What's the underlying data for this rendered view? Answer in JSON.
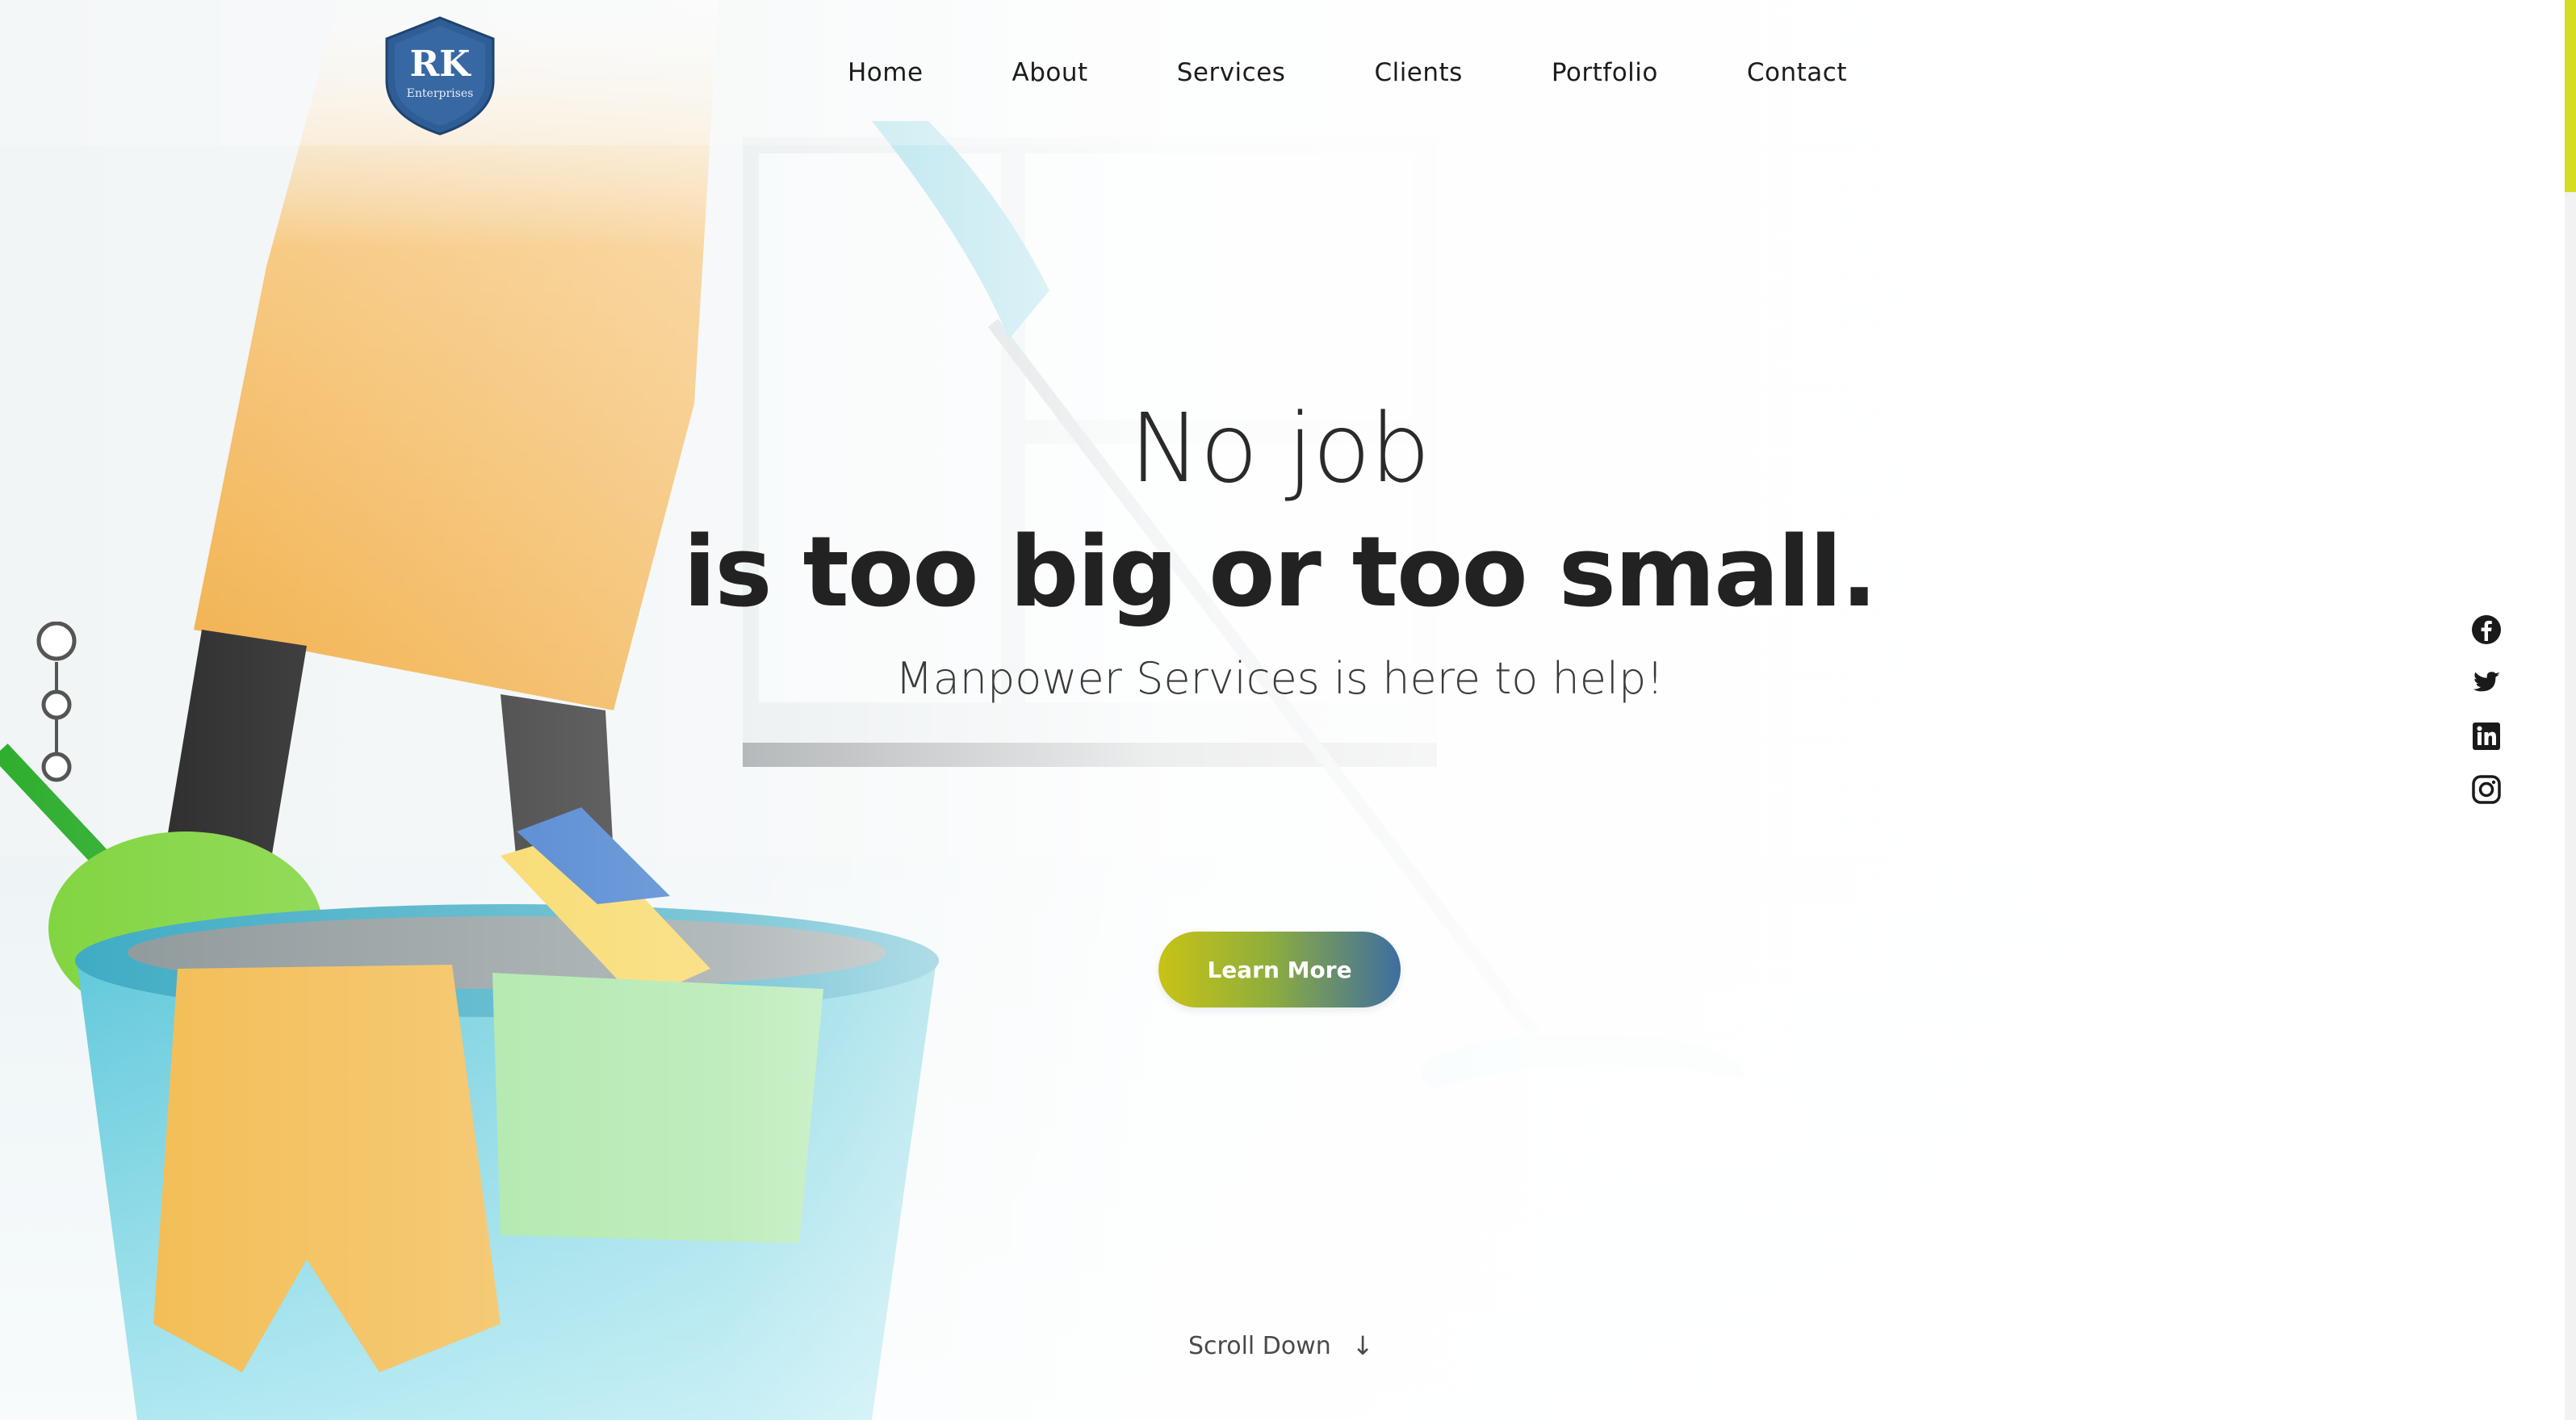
{
  "brand": {
    "logo_main": "RK",
    "logo_sub": "Enterprises",
    "logo_color": "#2f5d95"
  },
  "nav": {
    "items": [
      {
        "label": "Home"
      },
      {
        "label": "About"
      },
      {
        "label": "Services"
      },
      {
        "label": "Clients"
      },
      {
        "label": "Portfolio"
      },
      {
        "label": "Contact"
      }
    ]
  },
  "hero": {
    "headline_light": "No job",
    "headline_bold": "is too big or too small.",
    "subheadline": "Manpower Services is here to help!",
    "cta_label": "Learn More",
    "scroll_label": "Scroll Down",
    "scroll_icon": "↓"
  },
  "slider": {
    "slides": 3,
    "active_slide": 1
  },
  "social": {
    "icons": [
      "facebook-icon",
      "twitter-icon",
      "linkedin-icon",
      "instagram-icon"
    ]
  },
  "colors": {
    "accent_yellow": "#c8c316",
    "accent_blue": "#3e6ea1",
    "scrollbar_thumb": "#d6dc21",
    "text_dark": "#222222"
  },
  "page_scroll": {
    "position_fraction": 0.0
  }
}
